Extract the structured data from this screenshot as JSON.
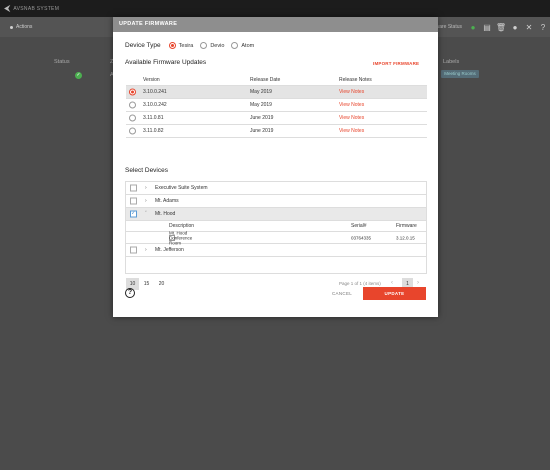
{
  "app": {
    "title": "AVSNAB SYSTEM",
    "subnav_tab": "Actions",
    "columns": {
      "status": "Status",
      "col2": "Z",
      "col3": "A",
      "labels": "Labels"
    },
    "status_right_text": "Firmware Status",
    "pill_text": "Meeting Rooms"
  },
  "modal": {
    "title": "UPDATE FIRMWARE",
    "device_type_label": "Device Type",
    "device_types": [
      "Tesira",
      "Devio",
      "Atom"
    ],
    "selected_device_type": "Tesira",
    "available_title": "Available Firmware Updates",
    "import_label": "IMPORT FIRMWARE",
    "firmware_columns": {
      "version": "Version",
      "release_date": "Release Date",
      "release_notes": "Release Notes"
    },
    "firmware": [
      {
        "version": "3.10.0.241",
        "date": "May 2019",
        "notes": "View Notes",
        "selected": true
      },
      {
        "version": "3.10.0.242",
        "date": "May 2019",
        "notes": "View Notes",
        "selected": false
      },
      {
        "version": "3.11.0.81",
        "date": "June 2019",
        "notes": "View Notes",
        "selected": false
      },
      {
        "version": "3.11.0.82",
        "date": "June 2019",
        "notes": "View Notes",
        "selected": false
      }
    ],
    "select_devices_title": "Select Devices",
    "devices": [
      {
        "name": "Executive Suite System"
      },
      {
        "name": "Mt. Adams"
      },
      {
        "name": "Mt. Hood"
      },
      {
        "name": "Mt. Jefferson"
      }
    ],
    "device_sub_columns": {
      "description": "Description",
      "serial": "Serial#",
      "firmware": "Firmware"
    },
    "device_sub_row": {
      "description": "Mt. Hood Conference Room",
      "serial": "03764335",
      "firmware": "3.12.0.15"
    },
    "pager": {
      "sizes": [
        "10",
        "15",
        "20"
      ],
      "info": "Page 1 of 1 (4 items)",
      "current": "1"
    },
    "help_glyph": "?",
    "cancel_label": "CANCEL",
    "update_label": "UPDATE"
  }
}
